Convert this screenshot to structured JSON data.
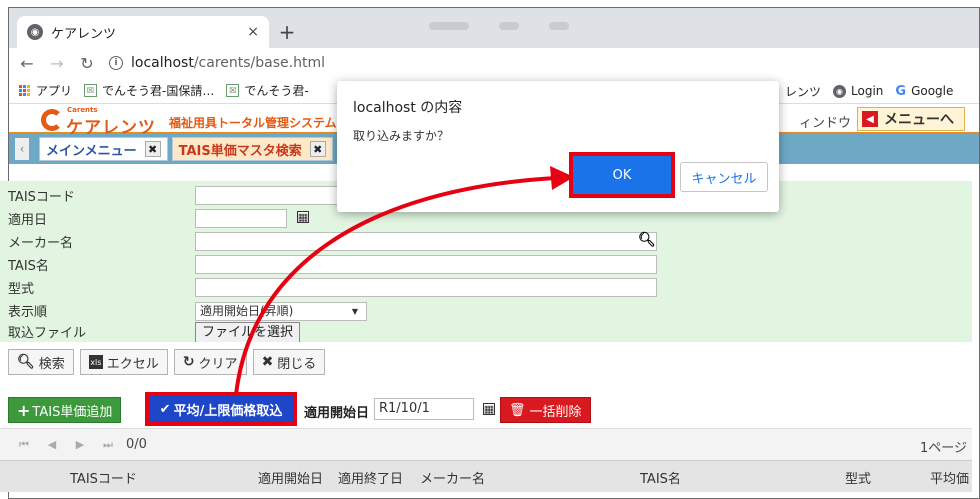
{
  "browser": {
    "tab_title": "ケアレンツ",
    "tab_close": "×",
    "new_tab": "+",
    "url_host": "localhost",
    "url_path": "/carents/base.html"
  },
  "bookmarks": {
    "apps": "アプリ",
    "item1": "でんそう君-国保請…",
    "item2": "でんそう君-",
    "right1": "レンツ",
    "right2": "Login",
    "right3": "Google"
  },
  "app": {
    "logo_small": "Carents",
    "logo_text": "ケアレンツ",
    "subtitle": "福祉用具トータル管理システム",
    "window_label": "ィンドウ",
    "menu_button": "メニューへ"
  },
  "app_tabs": {
    "main_menu": "メインメニュー",
    "tais_search": "TAIS単価マスタ検索",
    "close_glyph": "✖"
  },
  "form": {
    "tais_code_label": "TAISコード",
    "apply_date_label": "適用日",
    "maker_label": "メーカー名",
    "tais_name_label": "TAIS名",
    "model_label": "型式",
    "order_label": "表示順",
    "order_value": "適用開始日(昇順)",
    "import_file_label": "取込ファイル",
    "file_button": "ファイルを選択"
  },
  "toolbar": {
    "search": "検索",
    "excel": "エクセル",
    "clear": "クリア",
    "close": "閉じる"
  },
  "actions": {
    "add_price": "TAIS単価追加",
    "import_avg": "平均/上限価格取込",
    "start_date_label": "適用開始日",
    "start_date_value": "R1/10/1",
    "bulk_delete": "一括削除"
  },
  "pager": {
    "count": "0/0",
    "page_info": "1ページ"
  },
  "table": {
    "columns": [
      "TAISコード",
      "適用開始日",
      "適用終了日",
      "メーカー名",
      "TAIS名",
      "型式",
      "平均価"
    ]
  },
  "dialog": {
    "title": "localhost の内容",
    "message": "取り込みますか？",
    "ok": "OK",
    "cancel": "キャンセル"
  },
  "colors": {
    "accent_orange": "#e55a13",
    "highlight_red": "#e50012",
    "form_bg": "#e1f5e1",
    "tab_bar": "#6da9c4",
    "primary_blue": "#1a73e8"
  }
}
